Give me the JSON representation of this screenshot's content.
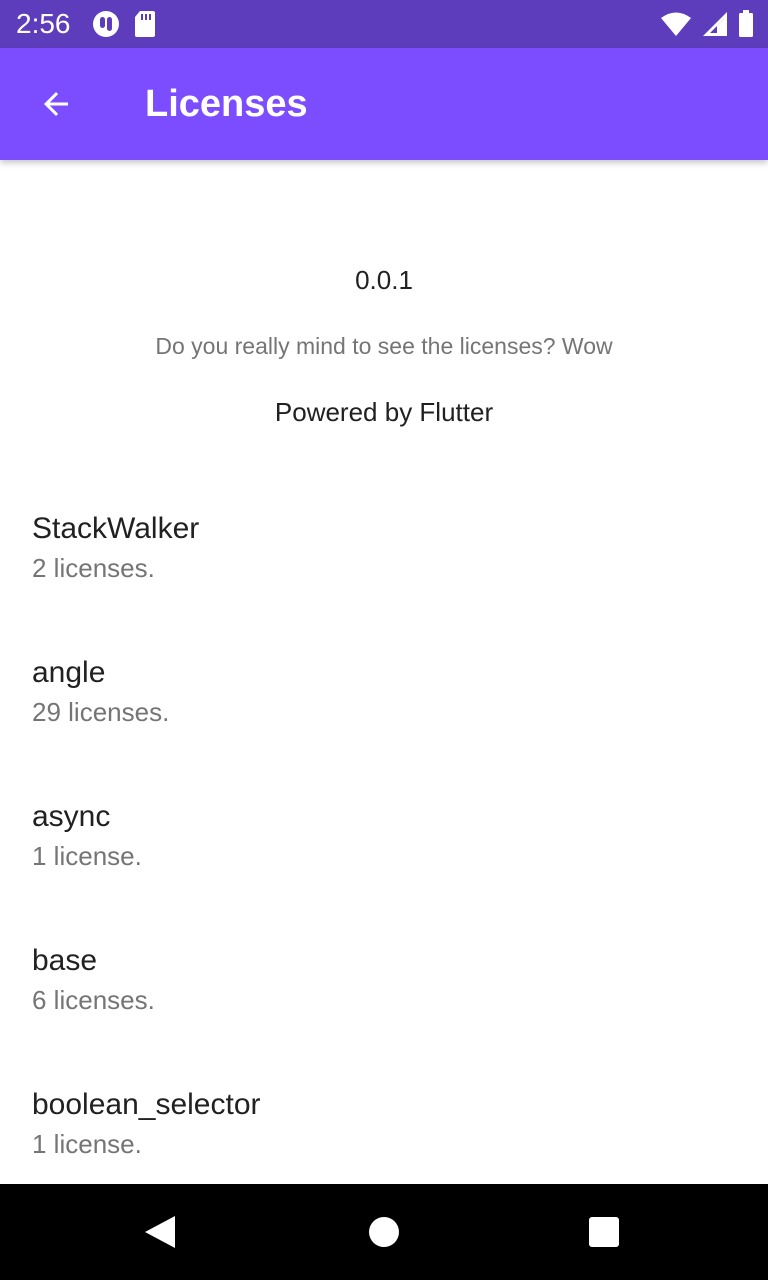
{
  "status_bar": {
    "time": "2:56",
    "left_icons": [
      "notification-app-icon",
      "sd-card-icon"
    ],
    "right_icons": [
      "wifi-icon",
      "cellular-signal-icon",
      "battery-icon"
    ]
  },
  "app_bar": {
    "back_icon": "arrow-back-icon",
    "title": "Licenses",
    "color": "#7c4dff"
  },
  "about": {
    "version": "0.0.1",
    "legalese": "Do you really mind to see the licenses? Wow",
    "powered_by": "Powered by Flutter"
  },
  "packages": [
    {
      "name": "StackWalker",
      "count": "2 licenses."
    },
    {
      "name": "angle",
      "count": "29 licenses."
    },
    {
      "name": "async",
      "count": "1 license."
    },
    {
      "name": "base",
      "count": "6 licenses."
    },
    {
      "name": "boolean_selector",
      "count": "1 license."
    }
  ],
  "nav_bar": {
    "icons": [
      "nav-back-icon",
      "nav-home-icon",
      "nav-recents-icon"
    ]
  },
  "colors": {
    "status_bar": "#5e3dbd",
    "app_bar": "#7c4dff",
    "primary_text": "#212121",
    "secondary_text": "#757575"
  }
}
